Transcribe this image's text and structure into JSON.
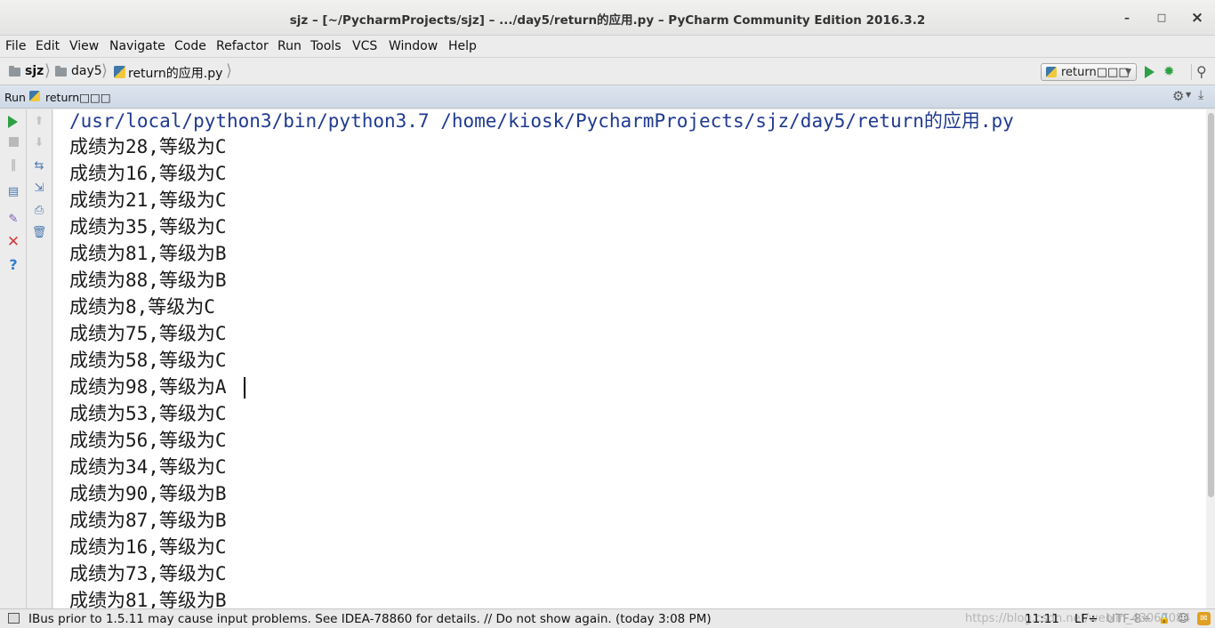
{
  "window": {
    "title": "sjz – [~/PycharmProjects/sjz] – .../day5/return的应用.py – PyCharm Community Edition 2016.3.2",
    "minimize": "–",
    "maximize": "□",
    "close": "×"
  },
  "menu": [
    "File",
    "Edit",
    "View",
    "Navigate",
    "Code",
    "Refactor",
    "Run",
    "Tools",
    "VCS",
    "Window",
    "Help"
  ],
  "breadcrumb": {
    "project": "sjz",
    "folder": "day5",
    "file": "return的应用.py"
  },
  "run_config": {
    "label": "return□□□"
  },
  "run_panel": {
    "title": "Run",
    "tab": "return□□□"
  },
  "console": {
    "command": "/usr/local/python3/bin/python3.7 /home/kiosk/PycharmProjects/sjz/day5/return的应用.py",
    "lines": [
      "成绩为28,等级为C",
      "成绩为16,等级为C",
      "成绩为21,等级为C",
      "成绩为35,等级为C",
      "成绩为81,等级为B",
      "成绩为88,等级为B",
      "成绩为8,等级为C",
      "成绩为75,等级为C",
      "成绩为58,等级为C",
      "成绩为98,等级为A",
      "成绩为53,等级为C",
      "成绩为56,等级为C",
      "成绩为34,等级为C",
      "成绩为90,等级为B",
      "成绩为87,等级为B",
      "成绩为16,等级为C",
      "成绩为73,等级为C",
      "成绩为81,等级为B"
    ]
  },
  "status": {
    "message": "IBus prior to 1.5.11 may cause input problems. See IDEA-78860 for details. // Do not show again. (today 3:08 PM)",
    "position": "11:11",
    "line_sep": "LF÷",
    "encoding": "UTF-8÷",
    "watermark": "https://blog.csdn.net/weixin_43067084"
  },
  "colors": {
    "run_green": "#2ea043",
    "close_red": "#d83a3a",
    "help_blue": "#2f7fd1"
  }
}
